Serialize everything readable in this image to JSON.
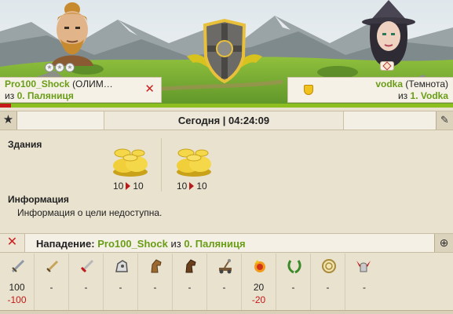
{
  "attacker": {
    "name": "Pro100_Shock",
    "race": "(ОЛИМ…",
    "from_word": "из",
    "province": "0. Паляниця",
    "rank_stars": 3
  },
  "defender": {
    "name": "vodka",
    "race": "(Темнота)",
    "from_word": "из",
    "province": "1. Vodka"
  },
  "battle": {
    "attacker_hp_fraction": 0.024,
    "time_label": "Сегодня | 04:24:09"
  },
  "buildings": {
    "title": "Здания",
    "items": [
      {
        "icon": "gold-coins-icon",
        "before": "10",
        "after": "10"
      },
      {
        "icon": "gold-coins-icon",
        "before": "10",
        "after": "10"
      }
    ]
  },
  "info": {
    "title": "Информация",
    "text": "Информация о цели недоступна."
  },
  "attack": {
    "label": "Нападение:",
    "player": "Pro100_Shock",
    "from_word": "из",
    "province": "0. Паляниця"
  },
  "units": [
    {
      "icon": "sword-icon",
      "count": "100",
      "loss": "-100"
    },
    {
      "icon": "dagger-icon",
      "count": "-",
      "loss": ""
    },
    {
      "icon": "red-sword-icon",
      "count": "-",
      "loss": ""
    },
    {
      "icon": "cavalry-icon",
      "count": "-",
      "loss": ""
    },
    {
      "icon": "horse-icon",
      "count": "-",
      "loss": ""
    },
    {
      "icon": "dark-horse-icon",
      "count": "-",
      "loss": ""
    },
    {
      "icon": "catapult-icon",
      "count": "-",
      "loss": ""
    },
    {
      "icon": "fireball-icon",
      "count": "20",
      "loss": "-20"
    },
    {
      "icon": "laurel-icon",
      "count": "-",
      "loss": ""
    },
    {
      "icon": "coin-icon",
      "count": "-",
      "loss": ""
    },
    {
      "icon": "winged-helm-icon",
      "count": "-",
      "loss": ""
    }
  ],
  "colors": {
    "accent_green": "#6a9d16",
    "loss_red": "#c21818",
    "panel_bg": "#e9e2cf"
  }
}
